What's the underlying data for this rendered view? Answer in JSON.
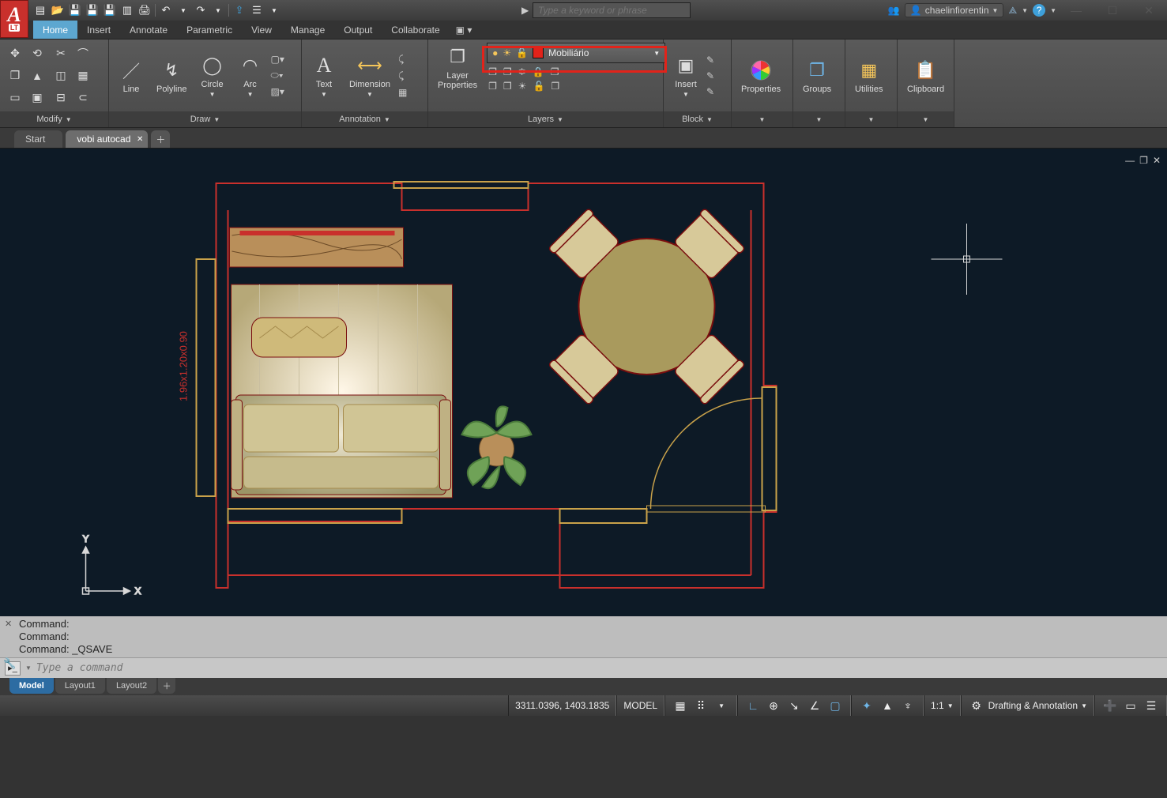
{
  "title": "vobi autocad.dwg",
  "search_placeholder": "Type a keyword or phrase",
  "user_name": "chaelinfiorentin",
  "menu_tabs": [
    "Home",
    "Insert",
    "Annotate",
    "Parametric",
    "View",
    "Manage",
    "Output",
    "Collaborate"
  ],
  "active_menu_tab": "Home",
  "ribbon": {
    "modify_label": "Modify",
    "draw_label": "Draw",
    "draw": {
      "line": "Line",
      "polyline": "Polyline",
      "circle": "Circle",
      "arc": "Arc"
    },
    "annotation_label": "Annotation",
    "annotation": {
      "text": "Text",
      "dimension": "Dimension"
    },
    "layers_label": "Layers",
    "layers": {
      "properties": "Layer\nProperties",
      "current": "Mobiliário"
    },
    "block_label": "Block",
    "block": {
      "insert": "Insert"
    },
    "properties_label": "Properties",
    "groups_label": "Groups",
    "utilities_label": "Utilities",
    "clipboard_label": "Clipboard"
  },
  "file_tabs": {
    "start": "Start",
    "open": "vobi autocad"
  },
  "dimension_text": "1.96x1.20x0.90",
  "axes": {
    "x": "X",
    "y": "Y"
  },
  "command_history": [
    "Command:",
    "Command:",
    "Command: _QSAVE"
  ],
  "command_placeholder": "Type a command",
  "layout_tabs": [
    "Model",
    "Layout1",
    "Layout2"
  ],
  "status": {
    "coords": "3311.0396, 1403.1835",
    "space": "MODEL",
    "scale": "1:1",
    "workspace": "Drafting & Annotation"
  }
}
